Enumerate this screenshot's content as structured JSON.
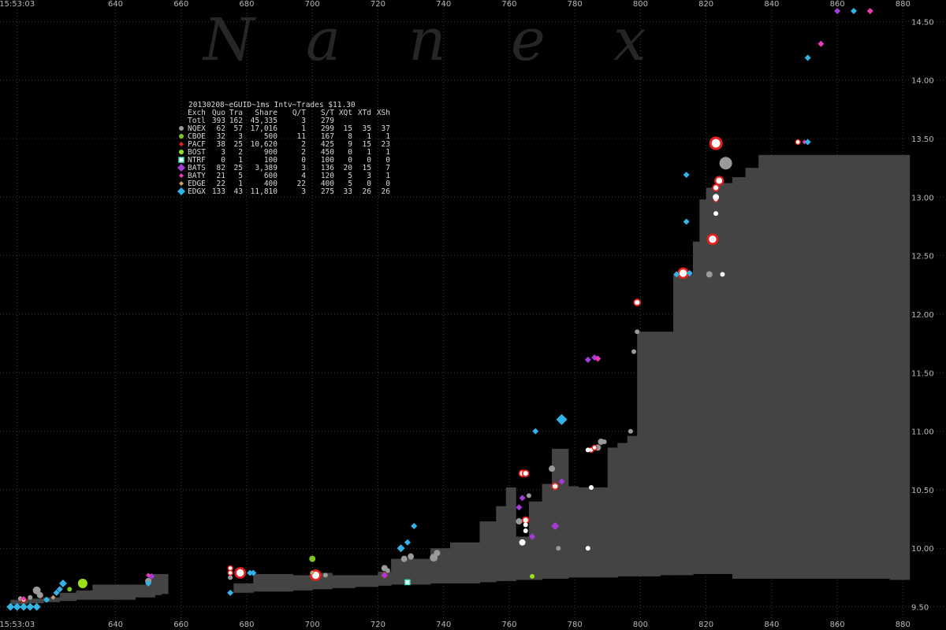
{
  "colors": {
    "background": "#000000",
    "grid": "#3a3a3a",
    "spread": "#444444",
    "tick_text": "#b8b8b8",
    "NQEX": "#9a9a9a",
    "CBOE": "#7dc41f",
    "PACF": "#e8201c",
    "BOST": "#9be01a",
    "NTRF": "#3ee8c2",
    "BATS": "#a63bdb",
    "BATY": "#ea3bb9",
    "EDGE": "#c8a070",
    "EDGX": "#33b3e6"
  },
  "watermark": [
    "N",
    "a",
    "n",
    "e",
    "x"
  ],
  "legend": {
    "title": "20130208~eGUID~1ms Intv~Trades $11.30",
    "header": [
      "Exch",
      "Quo",
      "Tra",
      "Share",
      "Q/T",
      "S/T",
      "XQt",
      "XTd",
      "XSh"
    ],
    "total": [
      "Totl",
      "393",
      "162",
      "45,335",
      "3",
      "279",
      "",
      "",
      ""
    ],
    "rows": [
      {
        "exch": "NQEX",
        "quo": "62",
        "tra": "57",
        "share": "17,016",
        "qt": "1",
        "st": "299",
        "xqt": "15",
        "xtd": "35",
        "xsh": "37",
        "icon": "grey-circle-icon",
        "shape": "circle",
        "color_key": "NQEX"
      },
      {
        "exch": "CBOE",
        "quo": "32",
        "tra": "3",
        "share": "500",
        "qt": "11",
        "st": "167",
        "xqt": "8",
        "xtd": "1",
        "xsh": "1",
        "icon": "green-circle-icon",
        "shape": "circle",
        "color_key": "CBOE"
      },
      {
        "exch": "PACF",
        "quo": "38",
        "tra": "25",
        "share": "10,620",
        "qt": "2",
        "st": "425",
        "xqt": "9",
        "xtd": "15",
        "xsh": "23",
        "icon": "red-diamond-icon",
        "shape": "diamond",
        "color_key": "PACF"
      },
      {
        "exch": "BOST",
        "quo": "3",
        "tra": "2",
        "share": "900",
        "qt": "2",
        "st": "450",
        "xqt": "0",
        "xtd": "1",
        "xsh": "1",
        "icon": "lime-circle-icon",
        "shape": "circle",
        "color_key": "BOST"
      },
      {
        "exch": "NTRF",
        "quo": "0",
        "tra": "1",
        "share": "100",
        "qt": "0",
        "st": "100",
        "xqt": "0",
        "xtd": "0",
        "xsh": "0",
        "icon": "teal-square-icon",
        "shape": "square",
        "color_key": "NTRF"
      },
      {
        "exch": "BATS",
        "quo": "82",
        "tra": "25",
        "share": "3,389",
        "qt": "3",
        "st": "136",
        "xqt": "20",
        "xtd": "15",
        "xsh": "7",
        "icon": "purple-diamond-icon",
        "shape": "diamond",
        "color_key": "BATS"
      },
      {
        "exch": "BATY",
        "quo": "21",
        "tra": "5",
        "share": "600",
        "qt": "4",
        "st": "120",
        "xqt": "5",
        "xtd": "3",
        "xsh": "1",
        "icon": "pink-diamond-icon",
        "shape": "diamond",
        "color_key": "BATY"
      },
      {
        "exch": "EDGE",
        "quo": "22",
        "tra": "1",
        "share": "400",
        "qt": "22",
        "st": "400",
        "xqt": "5",
        "xtd": "0",
        "xsh": "0",
        "icon": "tan-diamond-icon",
        "shape": "diamond",
        "color_key": "EDGE"
      },
      {
        "exch": "EDGX",
        "quo": "133",
        "tra": "43",
        "share": "11,810",
        "qt": "3",
        "st": "275",
        "xqt": "33",
        "xtd": "26",
        "xsh": "26",
        "icon": "blue-diamond-icon",
        "shape": "diamond",
        "color_key": "EDGX"
      }
    ]
  },
  "chart_data": {
    "type": "scatter",
    "title": "20130208~eGUID~1ms Intv~Trades $11.30",
    "xlabel": "",
    "ylabel": "",
    "grid": true,
    "xlim": [
      606,
      884
    ],
    "ylim": [
      9.45,
      14.63
    ],
    "x_tick_labels": [
      {
        "x": 610,
        "label": "15:53:03"
      },
      {
        "x": 640,
        "label": "640"
      },
      {
        "x": 660,
        "label": "660"
      },
      {
        "x": 680,
        "label": "680"
      },
      {
        "x": 700,
        "label": "700"
      },
      {
        "x": 720,
        "label": "720"
      },
      {
        "x": 740,
        "label": "740"
      },
      {
        "x": 760,
        "label": "760"
      },
      {
        "x": 780,
        "label": "780"
      },
      {
        "x": 800,
        "label": "800"
      },
      {
        "x": 820,
        "label": "820"
      },
      {
        "x": 840,
        "label": "840"
      },
      {
        "x": 860,
        "label": "860"
      },
      {
        "x": 880,
        "label": "880"
      }
    ],
    "y_tick_labels": [
      {
        "y": 9.5,
        "label": "9.50"
      },
      {
        "y": 10.0,
        "label": "10.00"
      },
      {
        "y": 10.5,
        "label": "10.50"
      },
      {
        "y": 11.0,
        "label": "11.00"
      },
      {
        "y": 11.5,
        "label": "11.50"
      },
      {
        "y": 12.0,
        "label": "12.00"
      },
      {
        "y": 12.5,
        "label": "12.50"
      },
      {
        "y": 13.0,
        "label": "13.00"
      },
      {
        "y": 13.5,
        "label": "13.50"
      },
      {
        "y": 14.0,
        "label": "14.00"
      },
      {
        "y": 14.5,
        "label": "14.50"
      }
    ],
    "nbbo_spread": [
      {
        "x": 608,
        "bid": 9.52,
        "ask": 9.56
      },
      {
        "x": 613,
        "bid": 9.53,
        "ask": 9.57
      },
      {
        "x": 618,
        "bid": 9.54,
        "ask": 9.58
      },
      {
        "x": 623,
        "bid": 9.55,
        "ask": 9.62
      },
      {
        "x": 628,
        "bid": 9.56,
        "ask": 9.64
      },
      {
        "x": 633,
        "bid": 9.56,
        "ask": 9.69
      },
      {
        "x": 646,
        "bid": 9.58,
        "ask": 9.69
      },
      {
        "x": 650,
        "bid": 9.58,
        "ask": 9.78
      },
      {
        "x": 652,
        "bid": 9.6,
        "ask": 9.78
      },
      {
        "x": 654,
        "bid": 9.61,
        "ask": 9.78
      },
      {
        "x": 656,
        "bid": 9.62,
        "ask": 9.62
      },
      {
        "x": 676,
        "bid": 9.62,
        "ask": 9.7
      },
      {
        "x": 682,
        "bid": 9.63,
        "ask": 9.78
      },
      {
        "x": 694,
        "bid": 9.64,
        "ask": 9.77
      },
      {
        "x": 700,
        "bid": 9.65,
        "ask": 9.79
      },
      {
        "x": 706,
        "bid": 9.66,
        "ask": 9.77
      },
      {
        "x": 713,
        "bid": 9.67,
        "ask": 9.77
      },
      {
        "x": 720,
        "bid": 9.68,
        "ask": 9.8
      },
      {
        "x": 724,
        "bid": 9.69,
        "ask": 9.91
      },
      {
        "x": 736,
        "bid": 9.7,
        "ask": 10.0
      },
      {
        "x": 742,
        "bid": 9.7,
        "ask": 10.05
      },
      {
        "x": 751,
        "bid": 9.71,
        "ask": 10.23
      },
      {
        "x": 756,
        "bid": 9.72,
        "ask": 10.36
      },
      {
        "x": 759,
        "bid": 9.72,
        "ask": 10.52
      },
      {
        "x": 762,
        "bid": 9.73,
        "ask": 10.1
      },
      {
        "x": 766,
        "bid": 9.73,
        "ask": 10.4
      },
      {
        "x": 770,
        "bid": 9.74,
        "ask": 10.55
      },
      {
        "x": 773,
        "bid": 9.74,
        "ask": 10.85
      },
      {
        "x": 778,
        "bid": 9.75,
        "ask": 10.53
      },
      {
        "x": 781,
        "bid": 9.75,
        "ask": 10.52
      },
      {
        "x": 785,
        "bid": 9.75,
        "ask": 10.52
      },
      {
        "x": 790,
        "bid": 9.75,
        "ask": 10.86
      },
      {
        "x": 793,
        "bid": 9.76,
        "ask": 10.9
      },
      {
        "x": 796,
        "bid": 9.76,
        "ask": 10.96
      },
      {
        "x": 799,
        "bid": 9.76,
        "ask": 11.85
      },
      {
        "x": 802,
        "bid": 9.76,
        "ask": 11.85
      },
      {
        "x": 805,
        "bid": 9.76,
        "ask": 11.85
      },
      {
        "x": 806,
        "bid": 9.77,
        "ask": 11.85
      },
      {
        "x": 809,
        "bid": 9.77,
        "ask": 11.85
      },
      {
        "x": 810,
        "bid": 9.77,
        "ask": 12.34
      },
      {
        "x": 816,
        "bid": 9.78,
        "ask": 12.62
      },
      {
        "x": 818,
        "bid": 9.78,
        "ask": 12.98
      },
      {
        "x": 820,
        "bid": 9.78,
        "ask": 13.08
      },
      {
        "x": 824,
        "bid": 9.78,
        "ask": 13.12
      },
      {
        "x": 828,
        "bid": 9.74,
        "ask": 13.17
      },
      {
        "x": 832,
        "bid": 9.74,
        "ask": 13.25
      },
      {
        "x": 836,
        "bid": 9.74,
        "ask": 13.36
      },
      {
        "x": 876,
        "bid": 9.73,
        "ask": 13.36
      },
      {
        "x": 882,
        "bid": 9.73,
        "ask": 13.36
      }
    ],
    "series": [
      {
        "name": "NQEX",
        "shape": "circle",
        "color_key": "NQEX",
        "points": [
          {
            "x": 611,
            "y": 9.57,
            "s": 3
          },
          {
            "x": 614,
            "y": 9.58,
            "s": 3
          },
          {
            "x": 616,
            "y": 9.64,
            "s": 5
          },
          {
            "x": 617,
            "y": 9.6,
            "s": 4
          },
          {
            "x": 650,
            "y": 9.72,
            "s": 4
          },
          {
            "x": 675,
            "y": 9.75,
            "s": 3
          },
          {
            "x": 704,
            "y": 9.77,
            "s": 3
          },
          {
            "x": 722,
            "y": 9.83,
            "s": 4
          },
          {
            "x": 723,
            "y": 9.81,
            "s": 3
          },
          {
            "x": 728,
            "y": 9.91,
            "s": 4
          },
          {
            "x": 730,
            "y": 9.93,
            "s": 4
          },
          {
            "x": 737,
            "y": 9.92,
            "s": 5
          },
          {
            "x": 738,
            "y": 9.96,
            "s": 4
          },
          {
            "x": 763,
            "y": 10.23,
            "s": 4
          },
          {
            "x": 766,
            "y": 10.45,
            "s": 3
          },
          {
            "x": 773,
            "y": 10.68,
            "s": 4
          },
          {
            "x": 775,
            "y": 10.0,
            "s": 3
          },
          {
            "x": 787,
            "y": 10.86,
            "s": 4
          },
          {
            "x": 788,
            "y": 10.91,
            "s": 4
          },
          {
            "x": 789,
            "y": 10.91,
            "s": 3
          },
          {
            "x": 797,
            "y": 11.0,
            "s": 3
          },
          {
            "x": 798,
            "y": 11.68,
            "s": 3
          },
          {
            "x": 799,
            "y": 11.85,
            "s": 3
          },
          {
            "x": 821,
            "y": 12.34,
            "s": 4
          },
          {
            "x": 826,
            "y": 13.29,
            "s": 8
          }
        ]
      },
      {
        "name": "CBOE",
        "shape": "circle",
        "color_key": "CBOE",
        "points": [
          {
            "x": 626,
            "y": 9.65,
            "s": 3
          },
          {
            "x": 700,
            "y": 9.91,
            "s": 4
          },
          {
            "x": 700,
            "y": 9.79,
            "s": 3
          }
        ]
      },
      {
        "name": "PACF",
        "shape": "ring",
        "color_key": "PACF",
        "points": [
          {
            "x": 612,
            "y": 9.56,
            "s": 3
          },
          {
            "x": 675,
            "y": 9.83,
            "s": 3
          },
          {
            "x": 675,
            "y": 9.79,
            "s": 3
          },
          {
            "x": 678,
            "y": 9.79,
            "s": 6
          },
          {
            "x": 701,
            "y": 9.77,
            "s": 6
          },
          {
            "x": 722,
            "y": 9.77,
            "s": 3
          },
          {
            "x": 764,
            "y": 10.64,
            "s": 4
          },
          {
            "x": 765,
            "y": 10.64,
            "s": 4
          },
          {
            "x": 765,
            "y": 10.24,
            "s": 4
          },
          {
            "x": 774,
            "y": 10.53,
            "s": 4
          },
          {
            "x": 785,
            "y": 10.84,
            "s": 3
          },
          {
            "x": 786,
            "y": 10.86,
            "s": 3
          },
          {
            "x": 799,
            "y": 12.1,
            "s": 4
          },
          {
            "x": 813,
            "y": 12.35,
            "s": 6
          },
          {
            "x": 822,
            "y": 12.64,
            "s": 6
          },
          {
            "x": 823,
            "y": 12.98,
            "s": 3
          },
          {
            "x": 823,
            "y": 13.08,
            "s": 4
          },
          {
            "x": 824,
            "y": 13.14,
            "s": 5
          },
          {
            "x": 823,
            "y": 13.46,
            "s": 7
          },
          {
            "x": 848,
            "y": 13.47,
            "s": 3
          }
        ]
      },
      {
        "name": "BOST",
        "shape": "circle",
        "color_key": "BOST",
        "points": [
          {
            "x": 630,
            "y": 9.7,
            "s": 6
          },
          {
            "x": 767,
            "y": 9.76,
            "s": 3
          }
        ]
      },
      {
        "name": "NTRF",
        "shape": "square",
        "color_key": "NTRF",
        "points": [
          {
            "x": 729,
            "y": 9.71,
            "s": 3
          }
        ]
      },
      {
        "name": "BATS",
        "shape": "diamond",
        "color_key": "BATS",
        "points": [
          {
            "x": 651,
            "y": 9.76,
            "s": 4
          },
          {
            "x": 722,
            "y": 9.77,
            "s": 4
          },
          {
            "x": 763,
            "y": 10.35,
            "s": 4
          },
          {
            "x": 764,
            "y": 10.43,
            "s": 4
          },
          {
            "x": 767,
            "y": 10.1,
            "s": 4
          },
          {
            "x": 774,
            "y": 10.19,
            "s": 5
          },
          {
            "x": 776,
            "y": 10.57,
            "s": 4
          },
          {
            "x": 784,
            "y": 11.61,
            "s": 4
          },
          {
            "x": 786,
            "y": 11.63,
            "s": 4
          },
          {
            "x": 860,
            "y": 14.59,
            "s": 4
          }
        ]
      },
      {
        "name": "BATY",
        "shape": "diamond",
        "color_key": "BATY",
        "points": [
          {
            "x": 612,
            "y": 9.57,
            "s": 3
          },
          {
            "x": 650,
            "y": 9.77,
            "s": 3
          },
          {
            "x": 787,
            "y": 11.62,
            "s": 4
          },
          {
            "x": 850,
            "y": 13.47,
            "s": 3
          },
          {
            "x": 855,
            "y": 14.31,
            "s": 4
          },
          {
            "x": 870,
            "y": 14.59,
            "s": 4
          }
        ]
      },
      {
        "name": "EDGE",
        "shape": "diamond",
        "color_key": "EDGE",
        "points": [
          {
            "x": 621,
            "y": 9.58,
            "s": 3
          },
          {
            "x": 700,
            "y": 9.79,
            "s": 3
          }
        ]
      },
      {
        "name": "EDGX",
        "shape": "diamond",
        "color_key": "EDGX",
        "points": [
          {
            "x": 608,
            "y": 9.5,
            "s": 5
          },
          {
            "x": 610,
            "y": 9.5,
            "s": 5
          },
          {
            "x": 612,
            "y": 9.5,
            "s": 5
          },
          {
            "x": 614,
            "y": 9.5,
            "s": 5
          },
          {
            "x": 616,
            "y": 9.5,
            "s": 5
          },
          {
            "x": 619,
            "y": 9.56,
            "s": 4
          },
          {
            "x": 622,
            "y": 9.62,
            "s": 4
          },
          {
            "x": 623,
            "y": 9.65,
            "s": 4
          },
          {
            "x": 624,
            "y": 9.7,
            "s": 5
          },
          {
            "x": 650,
            "y": 9.7,
            "s": 4
          },
          {
            "x": 675,
            "y": 9.62,
            "s": 4
          },
          {
            "x": 681,
            "y": 9.79,
            "s": 4
          },
          {
            "x": 682,
            "y": 9.79,
            "s": 4
          },
          {
            "x": 727,
            "y": 10.0,
            "s": 5
          },
          {
            "x": 729,
            "y": 10.05,
            "s": 4
          },
          {
            "x": 731,
            "y": 10.19,
            "s": 4
          },
          {
            "x": 768,
            "y": 11.0,
            "s": 4
          },
          {
            "x": 776,
            "y": 11.1,
            "s": 7
          },
          {
            "x": 811,
            "y": 12.34,
            "s": 4
          },
          {
            "x": 815,
            "y": 12.35,
            "s": 4
          },
          {
            "x": 814,
            "y": 12.79,
            "s": 4
          },
          {
            "x": 814,
            "y": 13.19,
            "s": 4
          },
          {
            "x": 851,
            "y": 13.47,
            "s": 4
          },
          {
            "x": 851,
            "y": 14.19,
            "s": 4
          },
          {
            "x": 865,
            "y": 14.59,
            "s": 4
          }
        ]
      },
      {
        "name": "",
        "shape": "circle",
        "color_key": "white",
        "points": [
          {
            "x": 764,
            "y": 10.05,
            "s": 4
          },
          {
            "x": 765,
            "y": 10.15,
            "s": 3
          },
          {
            "x": 765,
            "y": 10.2,
            "s": 3
          },
          {
            "x": 774,
            "y": 10.53,
            "s": 3
          },
          {
            "x": 784,
            "y": 10.0,
            "s": 3
          },
          {
            "x": 785,
            "y": 10.52,
            "s": 3
          },
          {
            "x": 784,
            "y": 10.84,
            "s": 3
          },
          {
            "x": 823,
            "y": 12.86,
            "s": 3
          },
          {
            "x": 823,
            "y": 13.0,
            "s": 4
          },
          {
            "x": 825,
            "y": 12.34,
            "s": 3
          }
        ]
      }
    ]
  }
}
